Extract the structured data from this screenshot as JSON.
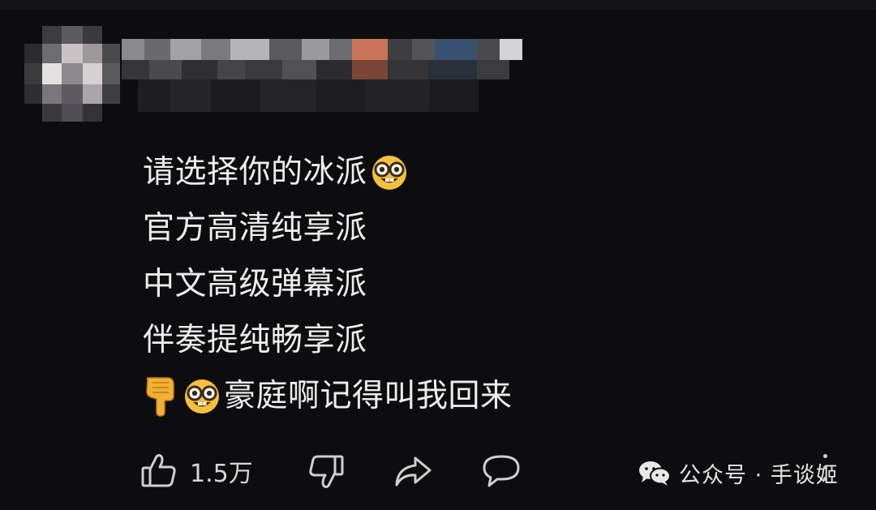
{
  "comment": {
    "lines": [
      "请选择你的冰派",
      "官方高清纯享派",
      "中文高级弹幕派",
      "伴奏提纯畅享派",
      "豪庭啊记得叫我回来"
    ],
    "emoji": [
      "nerd-face",
      "pointing-down",
      "nerd-face"
    ]
  },
  "actions": {
    "like_count": "1.5万",
    "icons": [
      "thumbs-up-icon",
      "thumbs-down-icon",
      "share-icon",
      "comment-icon"
    ]
  },
  "watermark": {
    "text": "公众号 · 手谈姬",
    "icon": "wechat-icon"
  },
  "colors": {
    "background": "#0d0d0f",
    "text": "#ededed",
    "icon": "#cfcfcf"
  }
}
